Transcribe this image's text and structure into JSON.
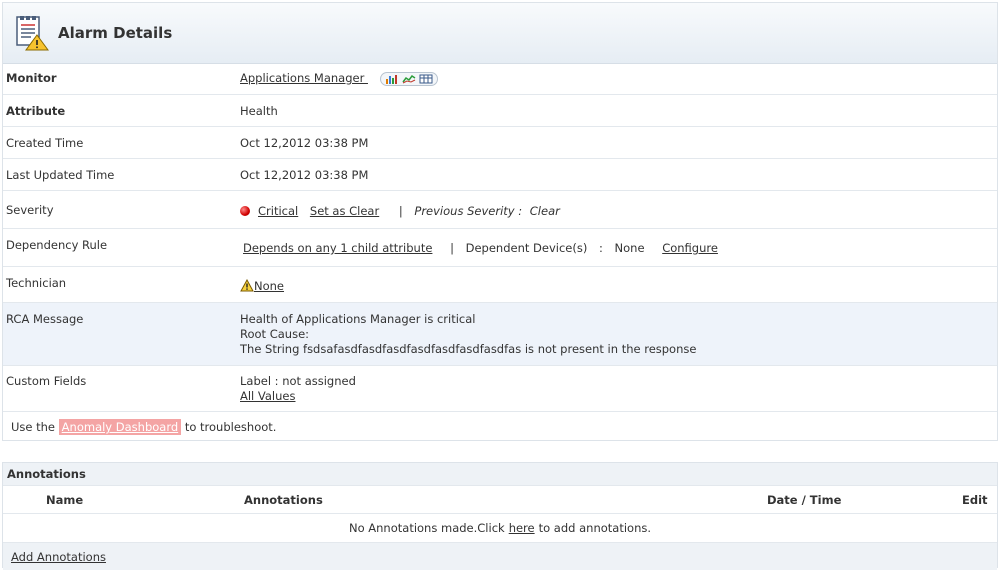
{
  "header": {
    "title": "Alarm Details",
    "icon": "alarm-document-warning-icon"
  },
  "fields": {
    "monitor": {
      "label": "Monitor",
      "value": "Applications Manager "
    },
    "attribute": {
      "label": "Attribute",
      "value": "Health"
    },
    "created": {
      "label": "Created  Time",
      "value": "Oct 12,2012 03:38 PM"
    },
    "updated": {
      "label": "Last Updated  Time",
      "value": "Oct 12,2012 03:38 PM"
    },
    "severity": {
      "label": "Severity",
      "value": "Critical",
      "set_clear": "Set as Clear",
      "separator": "|",
      "previous_label": "Previous Severity :",
      "previous_value": "Clear",
      "color": "#d10000"
    },
    "dependency": {
      "label": "Dependency Rule",
      "rule": "Depends on any 1 child attribute",
      "separator": "|",
      "devices_label": "Dependent Device(s)",
      "colon": ":",
      "devices_value": "None",
      "configure": "Configure"
    },
    "technician": {
      "label": "Technician",
      "value": "None"
    },
    "rca": {
      "label": "RCA Message",
      "line1": "Health of Applications Manager is critical",
      "line2": "Root Cause:",
      "line3": "The String fsdsafasdfasdfasdfasdfasdfasdfasdfas is not present in the response"
    },
    "custom": {
      "label": "Custom Fields",
      "value": "Label : not assigned",
      "link": "All Values"
    }
  },
  "troubleshoot": {
    "prefix": "Use the",
    "link": "Anomaly Dashboard",
    "suffix": "to troubleshoot."
  },
  "annotations": {
    "title": "Annotations",
    "columns": [
      "Name",
      "Annotations",
      "Date / Time",
      "Edit"
    ],
    "empty_prefix": "No Annotations made.Click",
    "empty_link": "here",
    "empty_suffix": "to add annotations.",
    "add_link": "Add Annotations"
  }
}
